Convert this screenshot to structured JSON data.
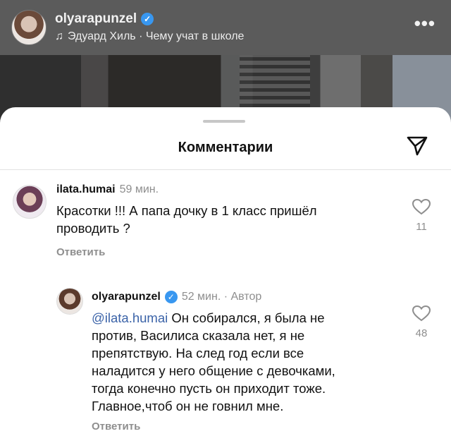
{
  "post": {
    "username": "olyarapunzel",
    "music": "Эдуард Хиль · Чему учат в школе",
    "more": "•••"
  },
  "sheet": {
    "title": "Комментарии"
  },
  "comments": [
    {
      "username": "ilata.humai",
      "time": "59 мин.",
      "text_lines": [
        "Красотки !!! А папа дочку в 1 класс пришёл",
        "проводить ?"
      ],
      "reply_label": "Ответить",
      "likes": "11"
    },
    {
      "username": "olyarapunzel",
      "time": "52 мин.",
      "author_label": "· Автор",
      "mention": "@ilata.humai",
      "text_lines": [
        " Он собирался, я была не",
        "против, Василиса сказала нет, я не",
        "препятствую. На след год если все",
        "наладится у него общение с девочками,",
        "тогда конечно пусть он приходит тоже.",
        "Главное,чтоб он не говнил мне."
      ],
      "reply_label": "Ответить",
      "likes": "48"
    }
  ],
  "colors": {
    "verified": "#3897f0",
    "mention": "#3b63a8",
    "muted": "#8e8e8e"
  },
  "icons": [
    "verified-icon",
    "music-note-icon",
    "more-icon",
    "share-send-icon",
    "heart-icon"
  ]
}
